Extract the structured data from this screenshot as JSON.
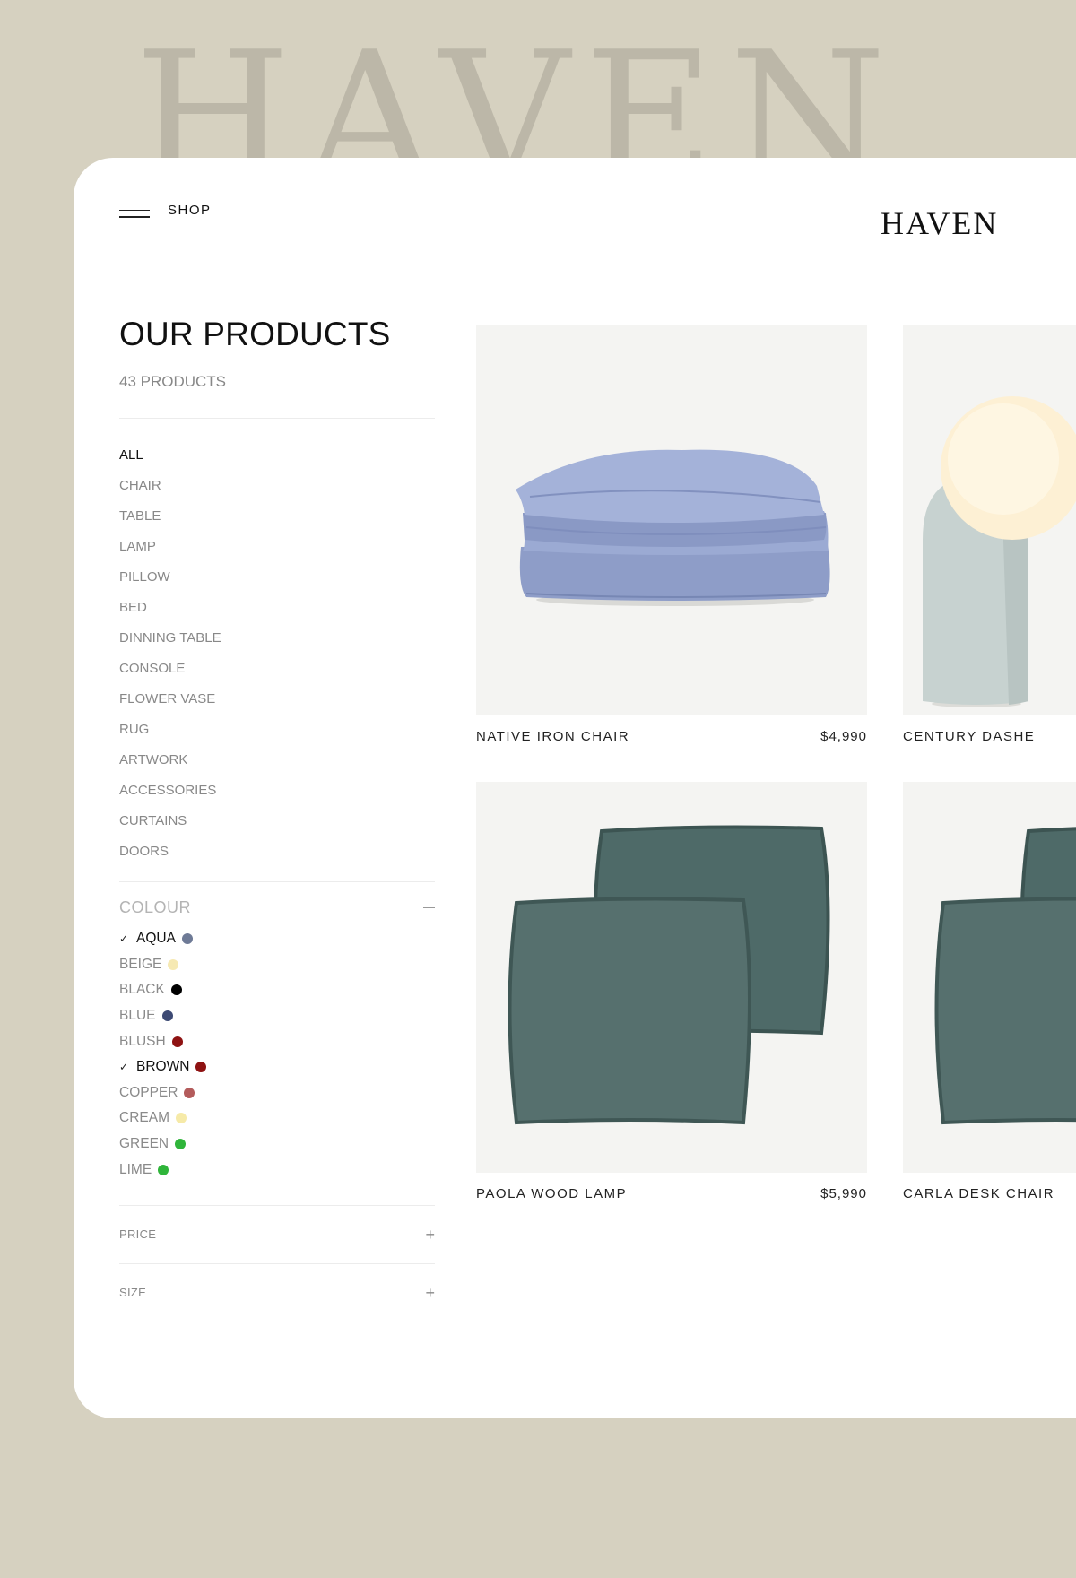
{
  "background_word": "HAVEN",
  "header": {
    "menu_label": "SHOP",
    "logo": "HAVEN"
  },
  "sidebar": {
    "title": "OUR PRODUCTS",
    "count": "43 PRODUCTS",
    "categories": [
      "ALL",
      "CHAIR",
      "TABLE",
      "LAMP",
      "PILLOW",
      "BED",
      "DINNING TABLE",
      "CONSOLE",
      "FLOWER VASE",
      "RUG",
      "ARTWORK",
      "ACCESSORIES",
      "CURTAINS",
      "DOORS"
    ],
    "active_category": "ALL",
    "colour": {
      "title": "COLOUR",
      "options": [
        {
          "label": "AQUA",
          "color": "#6e7a96",
          "checked": true
        },
        {
          "label": "BEIGE",
          "color": "#f6e9b3",
          "checked": false
        },
        {
          "label": "BLACK",
          "color": "#000000",
          "checked": false
        },
        {
          "label": "BLUE",
          "color": "#3d4a74",
          "checked": false
        },
        {
          "label": "BLUSH",
          "color": "#8e1212",
          "checked": false
        },
        {
          "label": "BROWN",
          "color": "#8e1212",
          "checked": true
        },
        {
          "label": "COPPER",
          "color": "#b35b5b",
          "checked": false
        },
        {
          "label": "CREAM",
          "color": "#f6eaa8",
          "checked": false
        },
        {
          "label": "GREEN",
          "color": "#2fb53a",
          "checked": false
        },
        {
          "label": "LIME",
          "color": "#2fb53a",
          "checked": false
        }
      ]
    },
    "price_label": "PRICE",
    "size_label": "SIZE"
  },
  "products": [
    {
      "name": "NATIVE IRON CHAIR",
      "price": "$4,990",
      "image": "folded-duvet"
    },
    {
      "name": "CENTURY DASHE",
      "price": "",
      "image": "globe-lamp"
    },
    {
      "name": "PAOLA WOOD LAMP",
      "price": "$5,990",
      "image": "pillows"
    },
    {
      "name": "CARLA DESK CHAIR",
      "price": "",
      "image": "pillows"
    }
  ]
}
